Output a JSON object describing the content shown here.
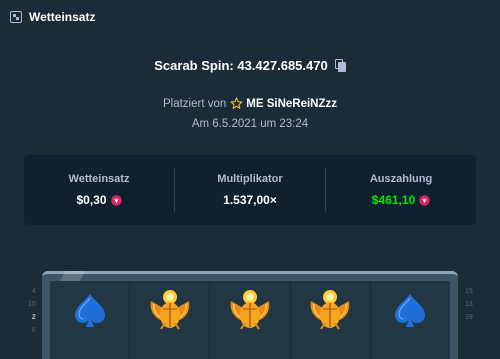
{
  "header": {
    "title": "Wetteinsatz",
    "icon": "dice-icon"
  },
  "bet": {
    "title": "Scarab Spin: 43.427.685.470",
    "placed_by_prefix": "Platziert von",
    "user": "ME SiNeReiNZzz",
    "date": "Am 6.5.2021 um 23:24"
  },
  "stats": {
    "wager_label": "Wetteinsatz",
    "wager_value": "$0,30",
    "multiplier_label": "Multiplikator",
    "multiplier_value": "1.537,00×",
    "payout_label": "Auszahlung",
    "payout_value": "$461,10"
  },
  "paylines": {
    "left": [
      "4",
      "10",
      "2",
      "6"
    ],
    "right": [
      "15",
      "13",
      "19"
    ]
  },
  "reels": [
    "spade",
    "scarab",
    "scarab",
    "scarab",
    "spade"
  ],
  "colors": {
    "background": "#1a2c38",
    "panel": "#0f212e",
    "muted_text": "#b1bad3",
    "payout_green": "#00e701",
    "coin_red": "#e0245e"
  }
}
